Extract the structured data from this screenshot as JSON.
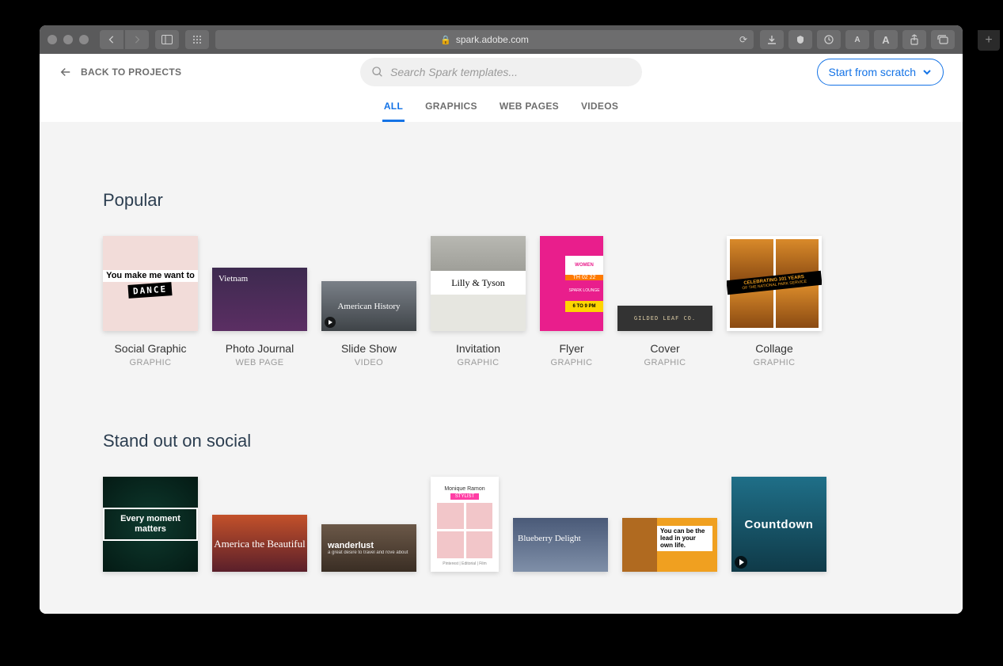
{
  "browser": {
    "url": "spark.adobe.com"
  },
  "header": {
    "back_label": "BACK TO PROJECTS",
    "search_placeholder": "Search Spark templates...",
    "start_button": "Start from scratch"
  },
  "tabs": [
    {
      "label": "ALL",
      "active": true
    },
    {
      "label": "GRAPHICS",
      "active": false
    },
    {
      "label": "WEB PAGES",
      "active": false
    },
    {
      "label": "VIDEOS",
      "active": false
    }
  ],
  "sections": {
    "popular": {
      "title": "Popular",
      "items": [
        {
          "title": "Social Graphic",
          "type": "GRAPHIC",
          "thumb_text": "You make me want to",
          "thumb_accent": "DANCE"
        },
        {
          "title": "Photo Journal",
          "type": "WEB PAGE",
          "thumb_text": "Vietnam"
        },
        {
          "title": "Slide Show",
          "type": "VIDEO",
          "thumb_text": "American History"
        },
        {
          "title": "Invitation",
          "type": "GRAPHIC",
          "thumb_text": "Lilly & Tyson"
        },
        {
          "title": "Flyer",
          "type": "GRAPHIC",
          "thumb_top": "WOMEN",
          "thumb_mid": "TH 02 22",
          "thumb_loc": "SPARK LOUNGE",
          "thumb_time": "6 TO 9 PM"
        },
        {
          "title": "Cover",
          "type": "GRAPHIC",
          "thumb_text": "GILDED LEAF CO."
        },
        {
          "title": "Collage",
          "type": "GRAPHIC",
          "thumb_text": "CELEBRATING 101 YEARS",
          "thumb_sub": "OF THE NATIONAL PARK SERVICE"
        }
      ]
    },
    "social": {
      "title": "Stand out on social",
      "items": [
        {
          "thumb_text": "Every moment matters"
        },
        {
          "thumb_text": "America the Beautiful"
        },
        {
          "thumb_text": "wanderlust",
          "thumb_sub": "a great desire to travel and rove about"
        },
        {
          "thumb_top": "Monique Ramon",
          "thumb_btn": "STYLIST",
          "thumb_ft": "Pinterest | Editorial | Film"
        },
        {
          "thumb_text": "Blueberry Delight"
        },
        {
          "thumb_text": "You can be the lead in your own life."
        },
        {
          "thumb_text": "Countdown"
        }
      ]
    }
  }
}
